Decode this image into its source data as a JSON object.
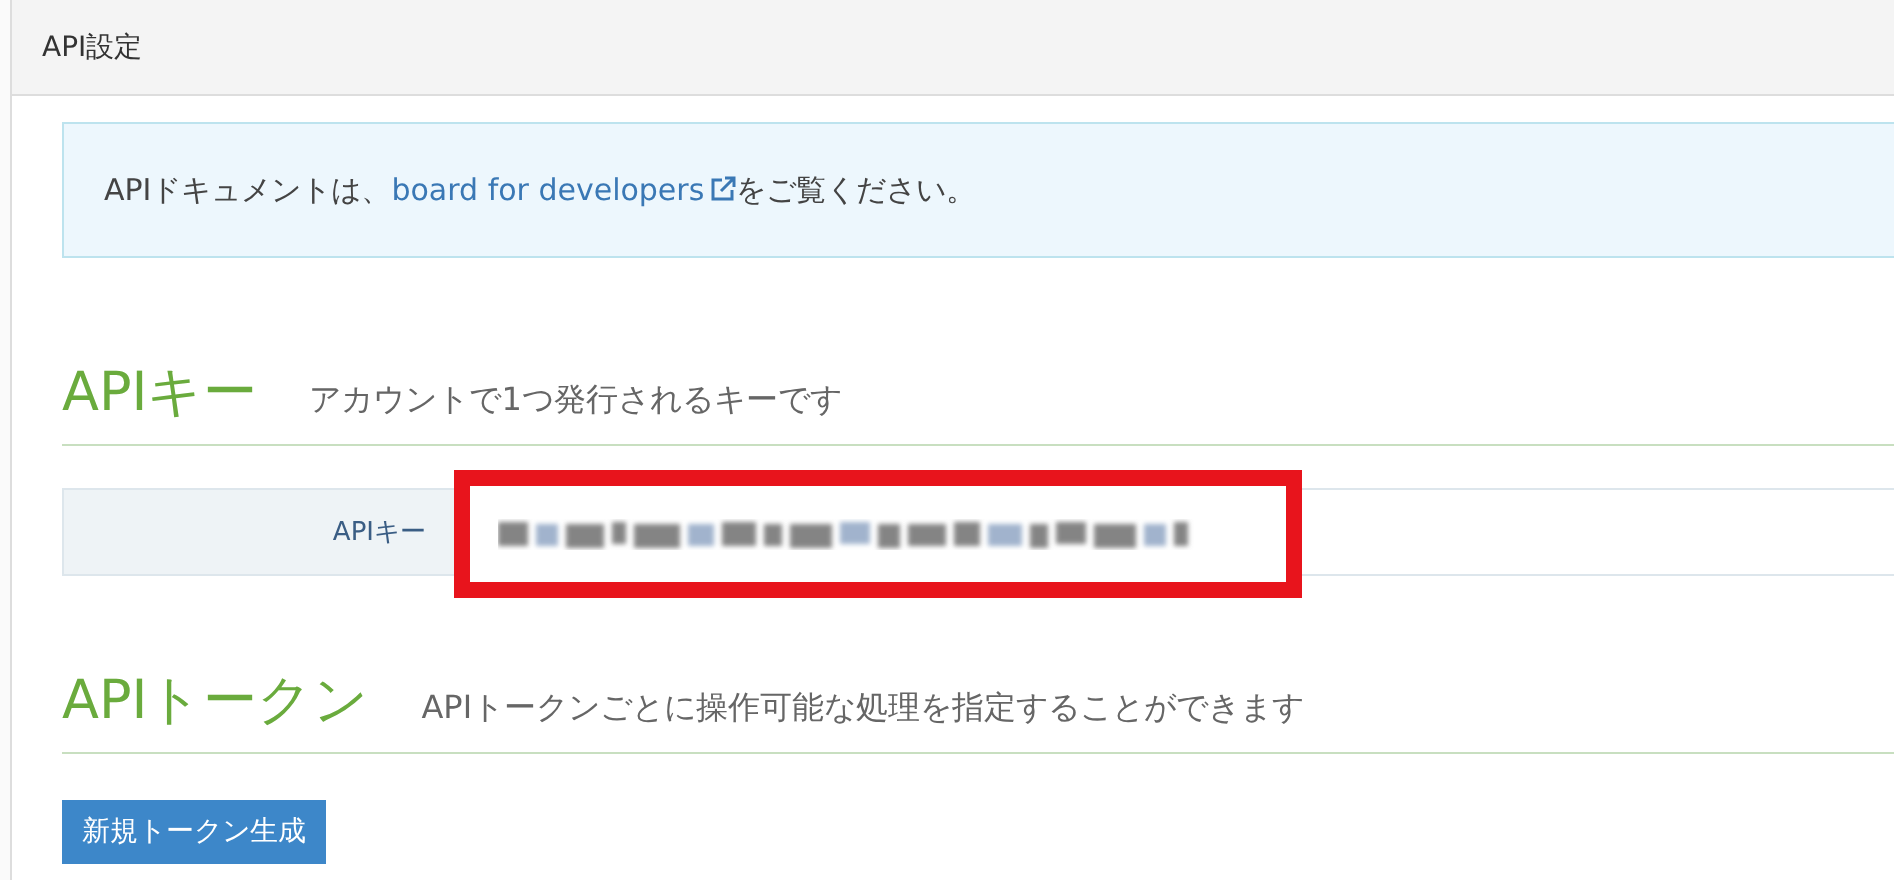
{
  "header": {
    "title": "API設定"
  },
  "notice": {
    "before": "APIドキュメントは、",
    "link": "board for developers",
    "after": "をご覧ください。"
  },
  "api_key_section": {
    "title": "APIキー",
    "subtitle": "アカウントで1つ発行されるキーです",
    "field_label": "APIキー",
    "value": {
      "kind": "redacted"
    }
  },
  "api_token_section": {
    "title": "APIトークン",
    "subtitle": "APIトークンごとに操作可能な処理を指定することができます",
    "button": "新規トークン生成"
  }
}
